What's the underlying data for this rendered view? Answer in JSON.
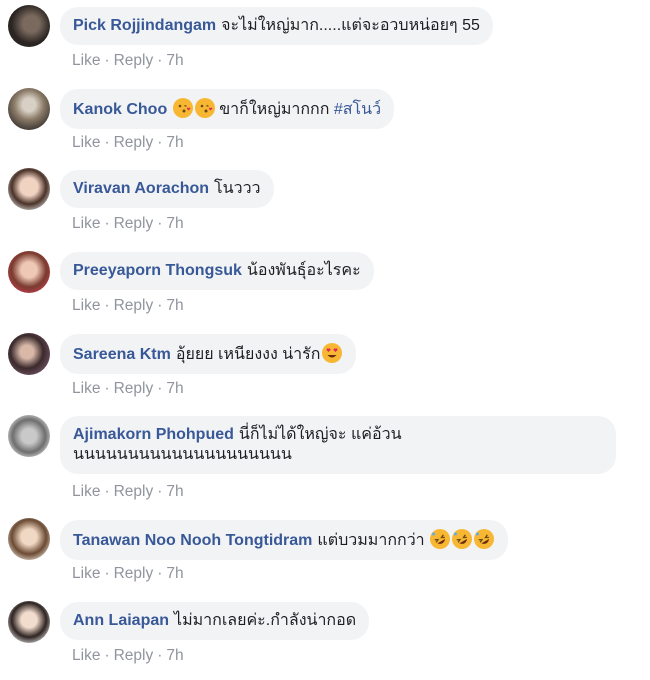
{
  "actions": {
    "like": "Like",
    "reply": "Reply",
    "sep": "·"
  },
  "comments": [
    {
      "author": "Pick Rojjindangam",
      "text": "จะไม่ใหญ่มาก.....แต่จะอวบหน่อยๆ 55",
      "time": "7h"
    },
    {
      "author": "Kanok Choo",
      "text": "ขาก็ใหญ่มากกก",
      "hashtag": "#สโนว์",
      "emoji": [
        "kissing-heart-emoji",
        "kissing-heart-emoji"
      ],
      "time": "7h"
    },
    {
      "author": "Viravan Aorachon",
      "text": "โนววว",
      "time": "7h"
    },
    {
      "author": "Preeyaporn Thongsuk",
      "text": "น้องพันธุ์อะไรคะ",
      "time": "7h"
    },
    {
      "author": "Sareena Ktm",
      "text": "อุ้ยยย เหนียงงง น่ารัก",
      "emoji": [
        "heart-eyes-emoji"
      ],
      "time": "7h"
    },
    {
      "author": "Ajimakorn Phohpued",
      "text": "นี่ก็ไม่ได้ใหญ่จะ แค่อ้วน",
      "text_line2": "นนนนนนนนนนนนนนนนนนนน",
      "time": "7h"
    },
    {
      "author": "Tanawan Noo Nooh Tongtidram",
      "text": "แต่บวมมากกว่า",
      "emoji": [
        "rofl-emoji",
        "rofl-emoji",
        "rofl-emoji"
      ],
      "time": "7h"
    },
    {
      "author": "Ann Laiapan",
      "text": "ไม่มากเลยค่ะ.กำลังน่ากอด",
      "time": "7h"
    }
  ]
}
